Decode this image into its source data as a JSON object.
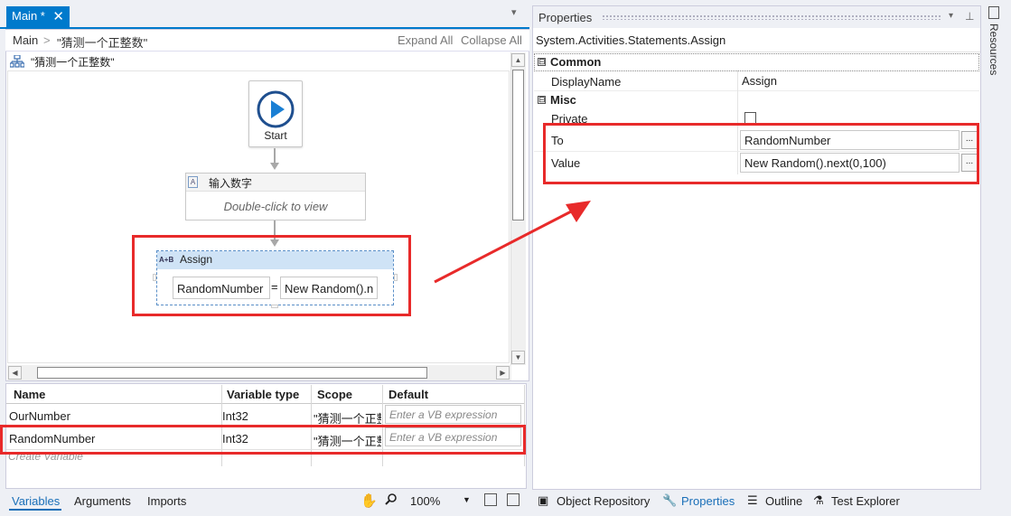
{
  "tab": {
    "label": "Main *",
    "close": "✕",
    "menu": "▾"
  },
  "breadcrumb": {
    "root": "Main",
    "separator": ">",
    "current": "\"猜测一个正整数\"",
    "expand_all": "Expand All",
    "collapse_all": "Collapse All"
  },
  "sequence": {
    "title": "\"猜测一个正整数\""
  },
  "workflow": {
    "start": {
      "label": "Start"
    },
    "input_activity": {
      "title": "输入数字",
      "hint": "Double-click to view"
    },
    "assign": {
      "icon_text": "A+B",
      "title": "Assign",
      "to": "RandomNumber",
      "equals": "=",
      "value": "New Random().n"
    }
  },
  "variables": {
    "headers": [
      "Name",
      "Variable type",
      "Scope",
      "Default"
    ],
    "rows": [
      {
        "name": "OurNumber",
        "type": "Int32",
        "scope": "\"猜测一个正整数\"",
        "default_placeholder": "Enter a VB expression"
      },
      {
        "name": "RandomNumber",
        "type": "Int32",
        "scope": "\"猜测一个正整数\"",
        "default_placeholder": "Enter a VB expression"
      }
    ],
    "create_placeholder": "Create Variable"
  },
  "bottom_tabs_left": {
    "variables": "Variables",
    "arguments": "Arguments",
    "imports": "Imports",
    "zoom": "100%",
    "zoom_dropdown": "▼"
  },
  "properties": {
    "title": "Properties",
    "dropdown": "▾",
    "pin": "⊥",
    "type_name": "System.Activities.Statements.Assign",
    "categories": {
      "common": {
        "toggle": "⊟",
        "label": "Common",
        "display_name_label": "DisplayName",
        "display_name_value": "Assign"
      },
      "misc": {
        "toggle": "⊟",
        "label": "Misc",
        "private_label": "Private",
        "to_label": "To",
        "to_value": "RandomNumber",
        "value_label": "Value",
        "value_value": "New Random().next(0,100)",
        "ellipsis": "..."
      }
    }
  },
  "bottom_tabs_right": {
    "object_repository": "Object Repository",
    "properties": "Properties",
    "outline": "Outline",
    "test_explorer": "Test Explorer"
  },
  "side_tabs": {
    "resources": "Resources"
  },
  "colors": {
    "accent": "#007acc",
    "annotation": "#e82a2a",
    "assign_header": "#cfe3f6"
  }
}
